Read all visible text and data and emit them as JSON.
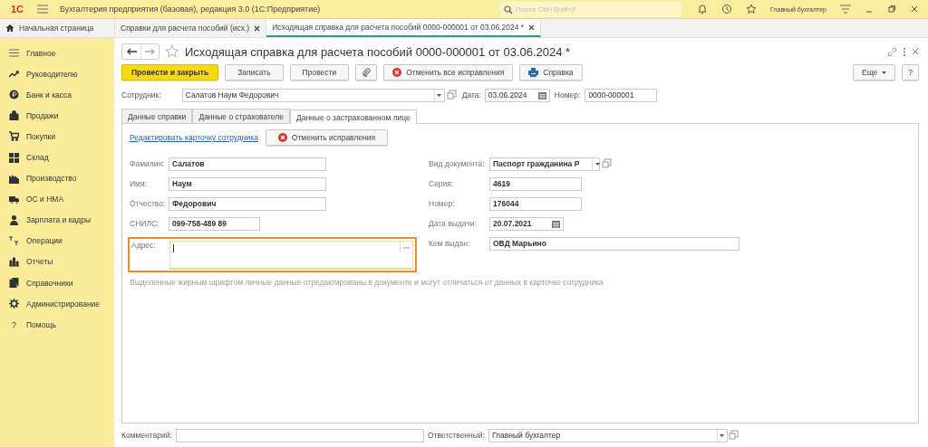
{
  "app_bar": {
    "logo": "1С",
    "title": "Бухгалтерия предприятия (базовая), редакция 3.0  (1С:Предприятие)",
    "search": {
      "placeholder": "Поиск Ctrl+Shift+F"
    },
    "user": "Главный бухгалтер"
  },
  "tabs": [
    {
      "label": "Начальная страница",
      "selected": false,
      "closable": false
    },
    {
      "label": "Справки для расчета пособий (исх.)",
      "selected": false,
      "closable": true
    },
    {
      "label": "Исходящая справка для расчета пособий 0000-000001 от 03.06.2024 *",
      "selected": true,
      "closable": true
    }
  ],
  "sidebar": {
    "items": [
      {
        "label": "Главное"
      },
      {
        "label": "Руководителю"
      },
      {
        "label": "Банк и касса"
      },
      {
        "label": "Продажи"
      },
      {
        "label": "Покупки"
      },
      {
        "label": "Склад"
      },
      {
        "label": "Производство"
      },
      {
        "label": "ОС и НМА"
      },
      {
        "label": "Зарплата и кадры"
      },
      {
        "label": "Операции"
      },
      {
        "label": "Отчеты"
      },
      {
        "label": "Справочники"
      },
      {
        "label": "Администрирование"
      },
      {
        "label": "Помощь",
        "glyph": "?"
      }
    ]
  },
  "document": {
    "title": "Исходящая справка для расчета пособий 0000-000001 от 03.06.2024 *",
    "toolbar": [
      {
        "kind": "primary",
        "label": "Провести и закрыть"
      },
      {
        "kind": "plain",
        "label": "Записать"
      },
      {
        "kind": "plain",
        "label": "Провести"
      },
      {
        "kind": "attach"
      },
      {
        "kind": "cancel",
        "label": "Отменить все исправления"
      },
      {
        "kind": "print",
        "label": "Справка"
      }
    ],
    "more": {
      "label": "Еще"
    },
    "help": {
      "label": "?"
    },
    "employee": {
      "label": "Сотрудник:",
      "value": "Салатов Наум Федорович"
    },
    "date": {
      "label": "Дата:",
      "value": "03.06.2024"
    },
    "number": {
      "label": "Номер:",
      "value": "0000-000001"
    },
    "inner_tabs": [
      {
        "label": "Данные справки",
        "selected": false
      },
      {
        "label": "Данные о страхователе",
        "selected": false
      },
      {
        "label": "Данные о застрахованном лице",
        "selected": true
      }
    ],
    "edit_link": "Редактировать карточку сотрудника",
    "cancel_button": "Отменить исправления",
    "left_fields": [
      {
        "kind": "text",
        "label": "Фамилия:",
        "value": "Салатов"
      },
      {
        "kind": "text",
        "label": "Имя:",
        "value": "Наум"
      },
      {
        "kind": "text",
        "label": "Отчество:",
        "value": "Федорович"
      },
      {
        "kind": "short",
        "label": "СНИЛС:",
        "value": "099-758-489 89"
      },
      {
        "kind": "memo",
        "label": "Адрес:",
        "highlighted": true
      }
    ],
    "right_fields": [
      {
        "kind": "select",
        "label": "Вид документа:",
        "value": "Паспорт гражданина Р"
      },
      {
        "kind": "short",
        "label": "Серия:",
        "value": "4619"
      },
      {
        "kind": "short",
        "label": "Номер:",
        "value": "176044"
      },
      {
        "kind": "date",
        "label": "Дата выдачи:",
        "value": "20.07.2021"
      },
      {
        "kind": "wide",
        "label": "Кем выдан:",
        "value": "ОВД  Марьино"
      }
    ],
    "note": "Выделенные жирным шрифтом личные данные отредактированы в документе и могут отличаться от данных в карточке сотрудника",
    "comment": {
      "label": "Комментарий:"
    },
    "responsible": {
      "label": "Ответственный:",
      "value": "Главный бухгалтер"
    }
  }
}
